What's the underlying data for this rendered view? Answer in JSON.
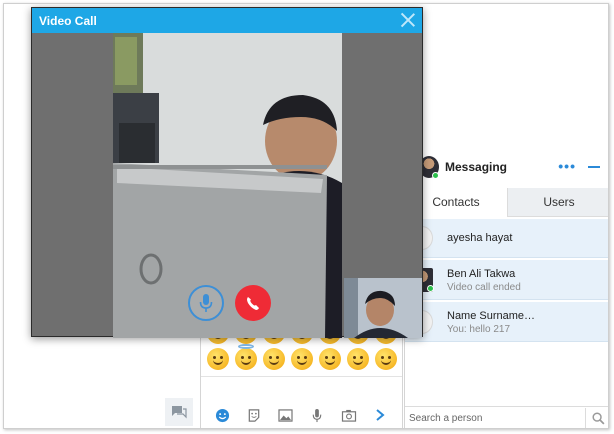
{
  "video_call": {
    "title": "Video Call"
  },
  "messaging": {
    "title": "Messaging",
    "tabs": [
      {
        "label": "Contacts",
        "active": true
      },
      {
        "label": "Users",
        "active": false
      }
    ],
    "contacts": [
      {
        "name": "ayesha hayat",
        "subtitle": "",
        "avatar": "placeholder",
        "online": false
      },
      {
        "name": "Ben Ali Takwa",
        "subtitle": "Video call ended",
        "avatar": "photo",
        "online": true
      },
      {
        "name": "Name Surname…",
        "subtitle": "You: hello 217",
        "avatar": "placeholder",
        "online": false
      }
    ],
    "search_placeholder": "Search a person"
  },
  "composer": {
    "emoji_rows": 2,
    "tools": [
      "emoji-icon",
      "sticker-icon",
      "image-icon",
      "microphone-icon",
      "camera-icon",
      "send-icon"
    ]
  },
  "colors": {
    "accent": "#1ea7e6",
    "end_call": "#ef2b36",
    "online": "#2bbf4b",
    "contact_bg": "#e7f1fa"
  }
}
